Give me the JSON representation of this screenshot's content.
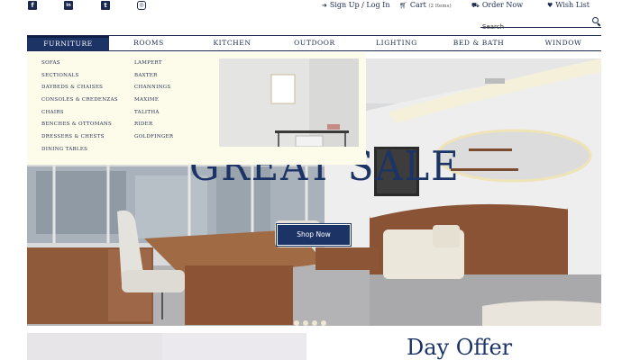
{
  "topbar": {
    "social": [
      {
        "name": "facebook-icon",
        "glyph": "f"
      },
      {
        "name": "linkedin-icon",
        "glyph": "in"
      },
      {
        "name": "twitter-icon",
        "glyph": "t"
      },
      {
        "name": "instagram-icon",
        "glyph": "◎"
      }
    ],
    "signup_label": "Sign Up / Log In",
    "cart_label": "Cart",
    "cart_count": "(2 Items)",
    "order_label": "Order Now",
    "wishlist_label": "Wish List"
  },
  "search": {
    "placeholder": "Search"
  },
  "nav": {
    "items": [
      "Furniture",
      "Rooms",
      "Kitchen",
      "Outdoor",
      "Lighting",
      "Bed & Bath",
      "Window"
    ],
    "active": "Furniture"
  },
  "dropdown": {
    "col1": [
      "Sofas",
      "Sectionals",
      "Daybeds & Chaises",
      "Consoles & Credenzas",
      "Chairs",
      "Benches & Ottomans",
      "Dressers & Chests",
      "Dining Tables"
    ],
    "col2": [
      "Lampert",
      "Baxter",
      "Channings",
      "Maxime",
      "Talitha",
      "Rider",
      "Goldfinger"
    ]
  },
  "hero": {
    "title": "GREAT SALE",
    "button": "Shop Now",
    "slide_count": 4
  },
  "bottom": {
    "heading": "Day Offer"
  },
  "colors": {
    "navy": "#1c3366",
    "dropdown_bg": "#fdfbea",
    "text": "#1b2a4e"
  }
}
